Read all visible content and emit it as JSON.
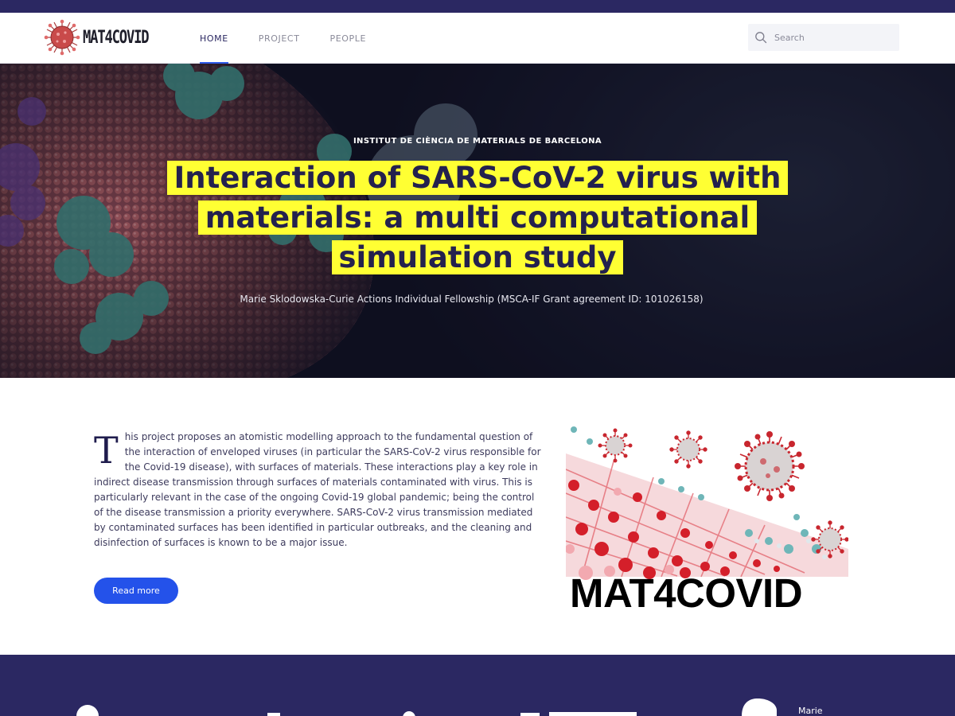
{
  "brand": {
    "name": "MAT4COVID",
    "logo_icon": "virus-logo-icon"
  },
  "nav": {
    "items": [
      {
        "label": "HOME",
        "active": true
      },
      {
        "label": "PROJECT",
        "active": false
      },
      {
        "label": "PEOPLE",
        "active": false
      }
    ]
  },
  "search": {
    "placeholder": "Search",
    "icon": "search-icon"
  },
  "hero": {
    "eyebrow": "INSTITUT DE CIÈNCIA DE MATERIALS DE BARCELONA",
    "title": "Interaction of SARS-CoV-2 virus with materials: a multi computational simulation study",
    "subtitle": "Marie Sklodowska-Curie Actions Individual Fellowship (MSCA-IF Grant agreement ID: 101026158)"
  },
  "intro": {
    "dropcap": "T",
    "text": "his project proposes an atomistic modelling approach to the fundamental question of the interaction of enveloped viruses (in particular the SARS-CoV-2 virus responsible for the Covid-19 disease), with surfaces of materials. These interactions play a key role in indirect disease transmission through surfaces of materials contaminated with virus. This is particularly relevant in the case of the ongoing Covid-19 global pandemic; being the control of the disease transmission a priority everywhere. SARS-CoV-2 virus transmission mediated by contaminated surfaces has been identified in particular outbreaks, and the cleaning and disinfection of surfaces is known to be a major issue.",
    "read_more": "Read more"
  },
  "figure": {
    "label": "MAT4COVID"
  },
  "footer": {
    "marie_text": "Marie"
  },
  "colors": {
    "navy": "#2b2862",
    "accent_blue": "#2452ea",
    "highlight_yellow": "#ffff33",
    "virus_red": "#c8262e"
  }
}
